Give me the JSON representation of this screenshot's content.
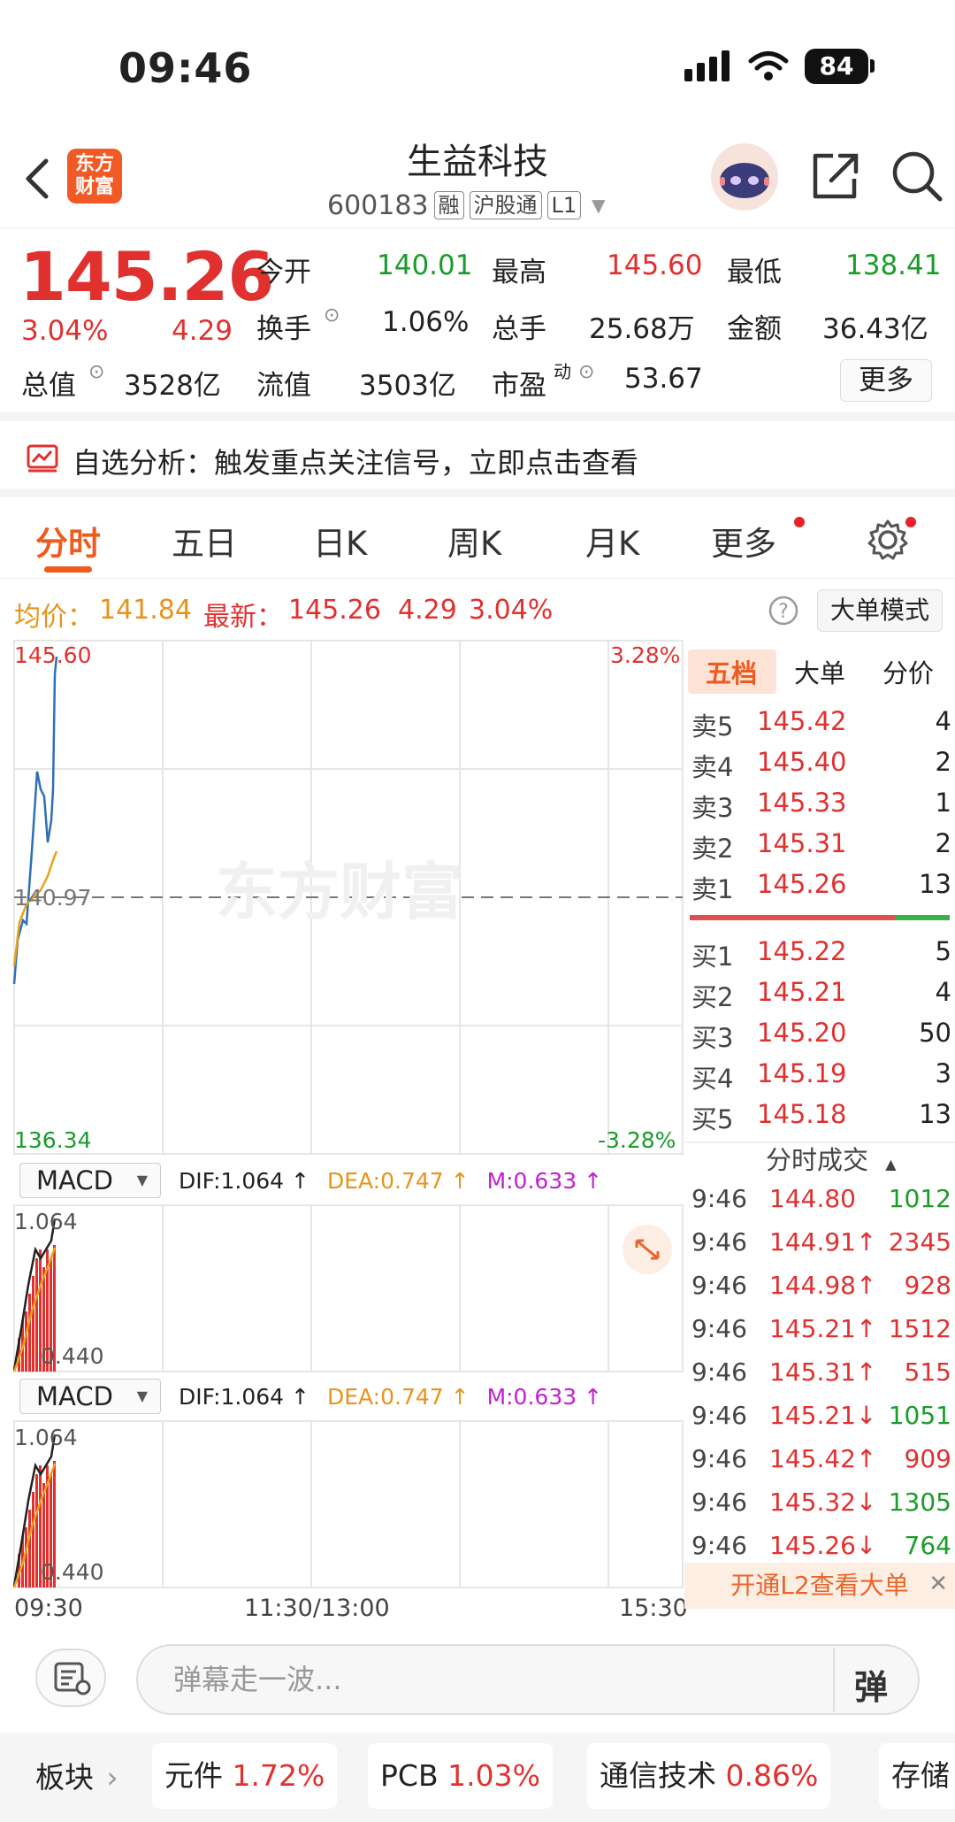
{
  "status_bar": {
    "time": "09:46",
    "battery": "84"
  },
  "header": {
    "logo": "东方财富",
    "stock_name": "生益科技",
    "code": "600183",
    "tags": [
      "融",
      "沪股通",
      "L1"
    ]
  },
  "quote": {
    "price": "145.26",
    "change_pct": "3.04%",
    "change": "4.29",
    "fields": {
      "open_label": "今开",
      "open": "140.01",
      "high_label": "最高",
      "high": "145.60",
      "low_label": "最低",
      "low": "138.41",
      "turnover_label": "换手",
      "turnover": "1.06%",
      "volume_label": "总手",
      "volume": "25.68万",
      "amount_label": "金额",
      "amount": "36.43亿",
      "mktcap_label": "总值",
      "mktcap": "3528亿",
      "float_label": "流值",
      "float": "3503亿",
      "pe_label": "市盈",
      "pe_sup": "动",
      "pe": "53.67"
    },
    "more_label": "更多"
  },
  "banner": {
    "text": "自选分析：触发重点关注信号，立即点击查看"
  },
  "tabs": [
    "分时",
    "五日",
    "日K",
    "周K",
    "月K",
    "更多"
  ],
  "info_row": {
    "avg_label": "均价：",
    "avg": "141.84",
    "latest_label": "最新：",
    "latest": "145.26",
    "latest_change": "4.29",
    "latest_pct": "3.04%",
    "big_order_label": "大单模式"
  },
  "chart": {
    "top_price": "145.60",
    "mid_price": "140.97",
    "bottom_price": "136.34",
    "top_pct": "3.28%",
    "bottom_pct": "-3.28%",
    "watermark": "东方财富",
    "macd": {
      "select": "MACD",
      "dif": "DIF:1.064 ↑",
      "dea": "DEA:0.747 ↑",
      "m": "M:0.633 ↑",
      "max": "1.064",
      "min": "0.440"
    },
    "time_labels": [
      "09:30",
      "11:30/13:00",
      "15:30"
    ]
  },
  "order_book": {
    "tabs": [
      "五档",
      "大单",
      "分价"
    ],
    "asks": [
      {
        "label": "卖5",
        "price": "145.42",
        "vol": "4"
      },
      {
        "label": "卖4",
        "price": "145.40",
        "vol": "2"
      },
      {
        "label": "卖3",
        "price": "145.33",
        "vol": "1"
      },
      {
        "label": "卖2",
        "price": "145.31",
        "vol": "2"
      },
      {
        "label": "卖1",
        "price": "145.26",
        "vol": "13"
      }
    ],
    "bids": [
      {
        "label": "买1",
        "price": "145.22",
        "vol": "5"
      },
      {
        "label": "买2",
        "price": "145.21",
        "vol": "4"
      },
      {
        "label": "买3",
        "price": "145.20",
        "vol": "50"
      },
      {
        "label": "买4",
        "price": "145.19",
        "vol": "3"
      },
      {
        "label": "买5",
        "price": "145.18",
        "vol": "13"
      }
    ],
    "trades_title": "分时成交",
    "trades": [
      {
        "time": "9:46",
        "price": "144.80",
        "vol": "1012",
        "dir": "",
        "vol_color": "green"
      },
      {
        "time": "9:46",
        "price": "144.91↑",
        "vol": "2345",
        "dir": "up",
        "vol_color": "red"
      },
      {
        "time": "9:46",
        "price": "144.98↑",
        "vol": "928",
        "dir": "up",
        "vol_color": "red"
      },
      {
        "time": "9:46",
        "price": "145.21↑",
        "vol": "1512",
        "dir": "up",
        "vol_color": "red"
      },
      {
        "time": "9:46",
        "price": "145.31↑",
        "vol": "515",
        "dir": "up",
        "vol_color": "red"
      },
      {
        "time": "9:46",
        "price": "145.21↓",
        "vol": "1051",
        "dir": "down",
        "vol_color": "green"
      },
      {
        "time": "9:46",
        "price": "145.42↑",
        "vol": "909",
        "dir": "up",
        "vol_color": "red"
      },
      {
        "time": "9:46",
        "price": "145.32↓",
        "vol": "1305",
        "dir": "down",
        "vol_color": "green"
      },
      {
        "time": "9:46",
        "price": "145.26↓",
        "vol": "764",
        "dir": "down",
        "vol_color": "green"
      }
    ],
    "l2_banner": "开通L2查看大单"
  },
  "danmu": {
    "placeholder": "弹幕走一波...",
    "button": "弹"
  },
  "sectors": {
    "label": "板块",
    "items": [
      {
        "name": "元件",
        "pct": "1.72%"
      },
      {
        "name": "PCB",
        "pct": "1.03%"
      },
      {
        "name": "通信技术",
        "pct": "0.86%"
      },
      {
        "name": "存储",
        "pct": ""
      }
    ]
  },
  "colors": {
    "up": "#e0312f",
    "down": "#1a9c2b",
    "accent": "#ef5a1f",
    "avg_line": "#e8a21a",
    "price_line": "#2f6fb5"
  }
}
